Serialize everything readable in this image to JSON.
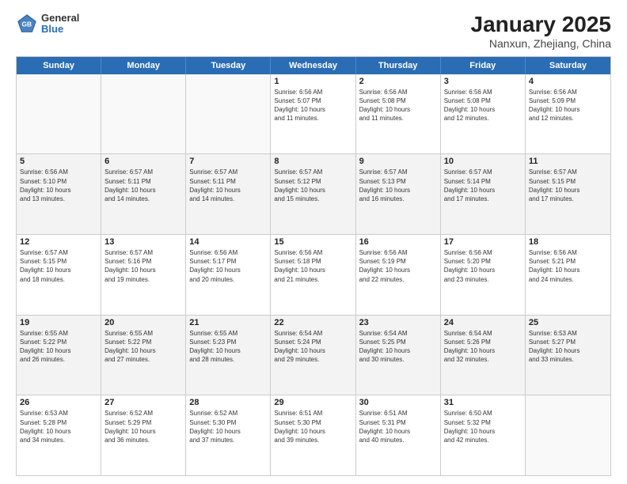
{
  "app": {
    "logo_general": "General",
    "logo_blue": "Blue",
    "title": "January 2025",
    "subtitle": "Nanxun, Zhejiang, China"
  },
  "calendar": {
    "headers": [
      "Sunday",
      "Monday",
      "Tuesday",
      "Wednesday",
      "Thursday",
      "Friday",
      "Saturday"
    ],
    "weeks": [
      [
        {
          "day": "",
          "info": ""
        },
        {
          "day": "",
          "info": ""
        },
        {
          "day": "",
          "info": ""
        },
        {
          "day": "1",
          "info": "Sunrise: 6:56 AM\nSunset: 5:07 PM\nDaylight: 10 hours\nand 11 minutes."
        },
        {
          "day": "2",
          "info": "Sunrise: 6:56 AM\nSunset: 5:08 PM\nDaylight: 10 hours\nand 11 minutes."
        },
        {
          "day": "3",
          "info": "Sunrise: 6:56 AM\nSunset: 5:08 PM\nDaylight: 10 hours\nand 12 minutes."
        },
        {
          "day": "4",
          "info": "Sunrise: 6:56 AM\nSunset: 5:09 PM\nDaylight: 10 hours\nand 12 minutes."
        }
      ],
      [
        {
          "day": "5",
          "info": "Sunrise: 6:56 AM\nSunset: 5:10 PM\nDaylight: 10 hours\nand 13 minutes."
        },
        {
          "day": "6",
          "info": "Sunrise: 6:57 AM\nSunset: 5:11 PM\nDaylight: 10 hours\nand 14 minutes."
        },
        {
          "day": "7",
          "info": "Sunrise: 6:57 AM\nSunset: 5:11 PM\nDaylight: 10 hours\nand 14 minutes."
        },
        {
          "day": "8",
          "info": "Sunrise: 6:57 AM\nSunset: 5:12 PM\nDaylight: 10 hours\nand 15 minutes."
        },
        {
          "day": "9",
          "info": "Sunrise: 6:57 AM\nSunset: 5:13 PM\nDaylight: 10 hours\nand 16 minutes."
        },
        {
          "day": "10",
          "info": "Sunrise: 6:57 AM\nSunset: 5:14 PM\nDaylight: 10 hours\nand 17 minutes."
        },
        {
          "day": "11",
          "info": "Sunrise: 6:57 AM\nSunset: 5:15 PM\nDaylight: 10 hours\nand 17 minutes."
        }
      ],
      [
        {
          "day": "12",
          "info": "Sunrise: 6:57 AM\nSunset: 5:15 PM\nDaylight: 10 hours\nand 18 minutes."
        },
        {
          "day": "13",
          "info": "Sunrise: 6:57 AM\nSunset: 5:16 PM\nDaylight: 10 hours\nand 19 minutes."
        },
        {
          "day": "14",
          "info": "Sunrise: 6:56 AM\nSunset: 5:17 PM\nDaylight: 10 hours\nand 20 minutes."
        },
        {
          "day": "15",
          "info": "Sunrise: 6:56 AM\nSunset: 5:18 PM\nDaylight: 10 hours\nand 21 minutes."
        },
        {
          "day": "16",
          "info": "Sunrise: 6:56 AM\nSunset: 5:19 PM\nDaylight: 10 hours\nand 22 minutes."
        },
        {
          "day": "17",
          "info": "Sunrise: 6:56 AM\nSunset: 5:20 PM\nDaylight: 10 hours\nand 23 minutes."
        },
        {
          "day": "18",
          "info": "Sunrise: 6:56 AM\nSunset: 5:21 PM\nDaylight: 10 hours\nand 24 minutes."
        }
      ],
      [
        {
          "day": "19",
          "info": "Sunrise: 6:55 AM\nSunset: 5:22 PM\nDaylight: 10 hours\nand 26 minutes."
        },
        {
          "day": "20",
          "info": "Sunrise: 6:55 AM\nSunset: 5:22 PM\nDaylight: 10 hours\nand 27 minutes."
        },
        {
          "day": "21",
          "info": "Sunrise: 6:55 AM\nSunset: 5:23 PM\nDaylight: 10 hours\nand 28 minutes."
        },
        {
          "day": "22",
          "info": "Sunrise: 6:54 AM\nSunset: 5:24 PM\nDaylight: 10 hours\nand 29 minutes."
        },
        {
          "day": "23",
          "info": "Sunrise: 6:54 AM\nSunset: 5:25 PM\nDaylight: 10 hours\nand 30 minutes."
        },
        {
          "day": "24",
          "info": "Sunrise: 6:54 AM\nSunset: 5:26 PM\nDaylight: 10 hours\nand 32 minutes."
        },
        {
          "day": "25",
          "info": "Sunrise: 6:53 AM\nSunset: 5:27 PM\nDaylight: 10 hours\nand 33 minutes."
        }
      ],
      [
        {
          "day": "26",
          "info": "Sunrise: 6:53 AM\nSunset: 5:28 PM\nDaylight: 10 hours\nand 34 minutes."
        },
        {
          "day": "27",
          "info": "Sunrise: 6:52 AM\nSunset: 5:29 PM\nDaylight: 10 hours\nand 36 minutes."
        },
        {
          "day": "28",
          "info": "Sunrise: 6:52 AM\nSunset: 5:30 PM\nDaylight: 10 hours\nand 37 minutes."
        },
        {
          "day": "29",
          "info": "Sunrise: 6:51 AM\nSunset: 5:30 PM\nDaylight: 10 hours\nand 39 minutes."
        },
        {
          "day": "30",
          "info": "Sunrise: 6:51 AM\nSunset: 5:31 PM\nDaylight: 10 hours\nand 40 minutes."
        },
        {
          "day": "31",
          "info": "Sunrise: 6:50 AM\nSunset: 5:32 PM\nDaylight: 10 hours\nand 42 minutes."
        },
        {
          "day": "",
          "info": ""
        }
      ]
    ]
  }
}
